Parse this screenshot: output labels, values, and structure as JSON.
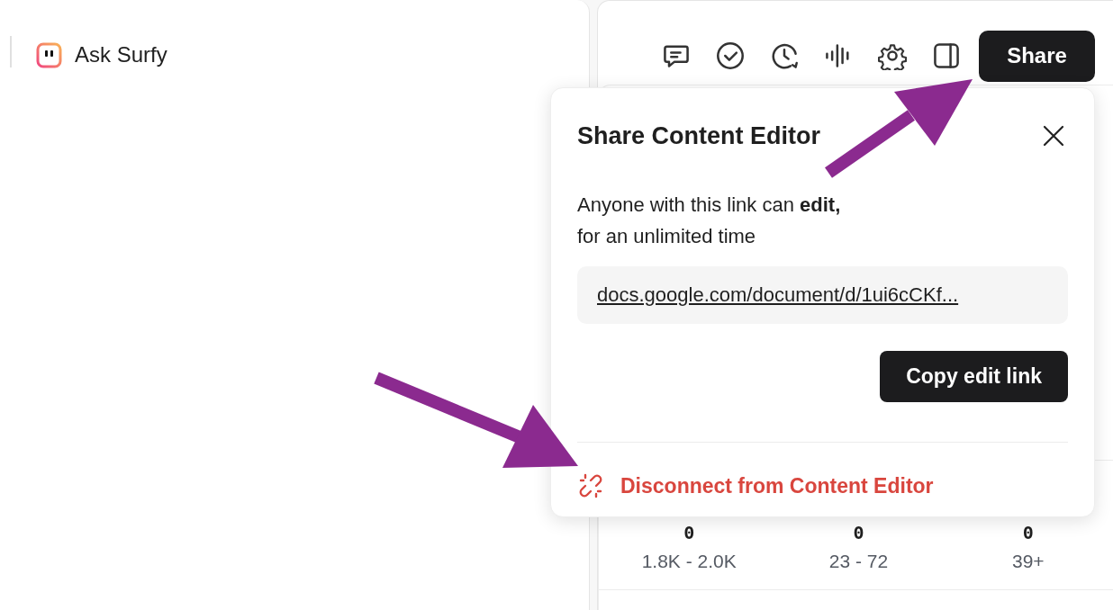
{
  "assistant": {
    "label": "Ask Surfy"
  },
  "toolbar": {
    "icons": [
      {
        "kind": "comment"
      },
      {
        "kind": "check"
      },
      {
        "kind": "history"
      },
      {
        "kind": "voice"
      },
      {
        "kind": "settings"
      },
      {
        "kind": "panel"
      }
    ],
    "share_button": "Share"
  },
  "share_dialog": {
    "title": "Share Content Editor",
    "message": "Anyone with this link can **edit,**",
    "message_line_2": "for an unlimited time",
    "link": "docs.google.com/document/d/1ui6cCKf...",
    "copy_button": "Copy edit link",
    "disconnect": "Disconnect from Content Editor"
  },
  "stats": [
    {
      "value": "0",
      "range": "1.8K - 2.0K"
    },
    {
      "value": "0",
      "range": "23 - 72"
    },
    {
      "value": "0",
      "range": "39+"
    }
  ],
  "annotations": [
    {
      "kind": "arrow"
    },
    {
      "kind": "arrow"
    }
  ]
}
